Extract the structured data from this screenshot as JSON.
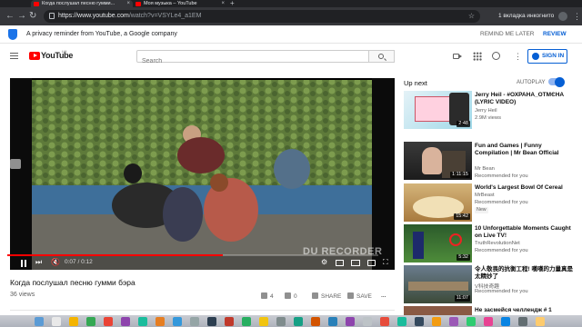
{
  "browser": {
    "tabs": [
      {
        "title": "Когда послушал песню гумми...",
        "active": true
      },
      {
        "title": "Моя музыка – YouTube",
        "active": false
      }
    ],
    "url_domain": "https://www.youtube.com",
    "url_path": "/watch?v=VSYLe4_a1EM",
    "incognito_label": "1 вкладка инкогнито"
  },
  "privacy": {
    "text": "A privacy reminder from YouTube, a Google company",
    "remind_label": "REMIND ME LATER",
    "review_label": "REVIEW"
  },
  "masthead": {
    "logo_text": "YouTube",
    "region": "UA",
    "search_placeholder": "Search",
    "signin_label": "SIGN IN"
  },
  "player": {
    "time": "0:07 / 0:12",
    "progress": 0.58,
    "watermark": "DU RECORDER"
  },
  "video": {
    "title": "Когда послушал песню гумми бэра",
    "views": "36 views",
    "likes": "4",
    "dislikes": "0",
    "share_label": "SHARE",
    "save_label": "SAVE",
    "more_label": "..."
  },
  "sidebar": {
    "up_next": "Up next",
    "autoplay": "AUTOPLAY",
    "autoplay_on": true,
    "items": [
      {
        "title": "Jerry Heil - #ОХРАНА_ОТМЄНА (LYRIC VIDEO)",
        "channel": "Jerry Heil",
        "meta": "2.9M views",
        "duration": "2:48"
      },
      {
        "title": "Fun and Games | Funny Compilation | Mr Bean Official",
        "channel": "Mr Bean",
        "meta": "Recommended for you",
        "duration": "1:11:15"
      },
      {
        "title": "World's Largest Bowl Of Cereal",
        "channel": "MrBeast",
        "meta": "Recommended for you",
        "badge": "New",
        "duration": "15:42"
      },
      {
        "title": "10 Unforgettable Moments Caught on Live TV!",
        "channel": "TruthRevolutionNet",
        "meta": "Recommended for you",
        "duration": "5:32"
      },
      {
        "title": "令人敬畏的抗衡工程! 嘆嘆的力量真是太精妙了",
        "channel": "V科技奇趣",
        "meta": "Recommended for you",
        "duration": "11:07"
      },
      {
        "title": "Не засмейся челлендж # 1",
        "channel": "",
        "meta": "",
        "duration": ""
      }
    ]
  },
  "colors": {
    "brand_red": "#ff0000",
    "link_blue": "#065fd4",
    "chrome_dark": "#202124"
  }
}
